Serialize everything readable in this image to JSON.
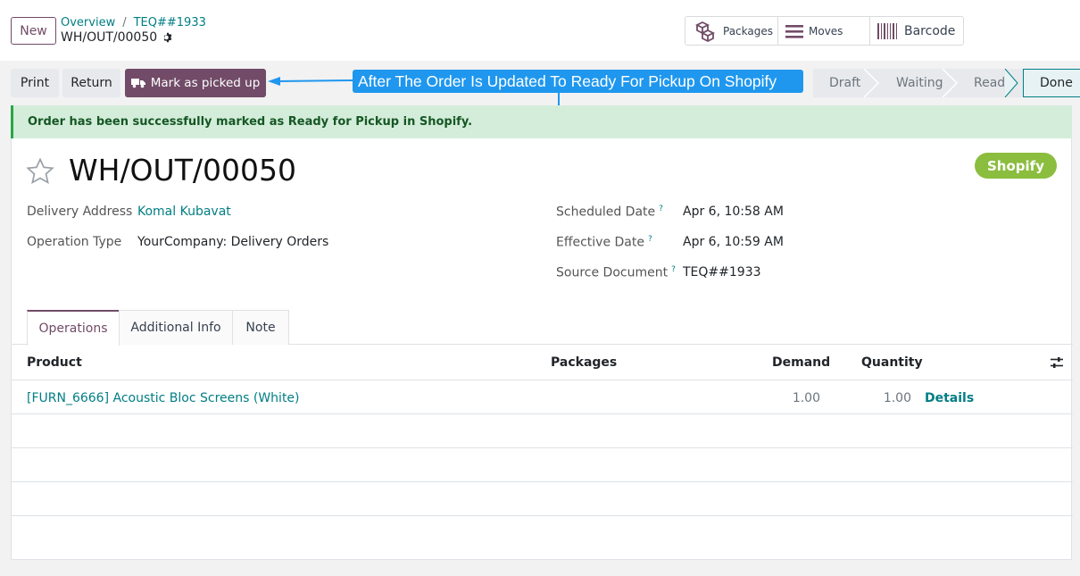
{
  "breadcrumb": {
    "new_label": "New",
    "overview": "Overview",
    "separator": "/",
    "source": "TEQ##1933",
    "record": "WH/OUT/00050"
  },
  "smart_buttons": {
    "packages": "Packages",
    "moves": "Moves",
    "barcode": "Barcode"
  },
  "actions": {
    "print": "Print",
    "return": "Return",
    "mark_picked": "Mark as picked up"
  },
  "annotation": "After The Order Is Updated To Ready For Pickup On Shopify",
  "statusbar": {
    "stages": [
      "Draft",
      "Waiting",
      "Ready",
      "Done"
    ],
    "current": "Done"
  },
  "alert": "Order has been successfully marked as Ready for Pickup in Shopify.",
  "record": {
    "title": "WH/OUT/00050",
    "tag": "Shopify",
    "delivery_address_label": "Delivery Address",
    "delivery_address": "Komal Kubavat",
    "operation_type_label": "Operation Type",
    "operation_type": "YourCompany: Delivery Orders",
    "scheduled_date_label": "Scheduled Date",
    "scheduled_date": "Apr 6, 10:58 AM",
    "effective_date_label": "Effective Date",
    "effective_date": "Apr 6, 10:59 AM",
    "source_document_label": "Source Document",
    "source_document": "TEQ##1933",
    "help_mark": "?"
  },
  "tabs": [
    "Operations",
    "Additional Info",
    "Note"
  ],
  "table": {
    "headers": {
      "product": "Product",
      "packages": "Packages",
      "demand": "Demand",
      "quantity": "Quantity"
    },
    "rows": [
      {
        "product": "[FURN_6666] Acoustic Bloc Screens (White)",
        "packages": "",
        "demand": "1.00",
        "quantity": "1.00",
        "details": "Details"
      }
    ]
  },
  "colors": {
    "brand": "#714b67",
    "link": "#017e84",
    "alert_bg": "#d4edda",
    "annotation": "#1f97ee",
    "tag": "#8bbd3e"
  },
  "icons": [
    "gear-icon",
    "packages-icon",
    "moves-icon",
    "barcode-icon",
    "truck-icon",
    "star-icon",
    "settings-icon"
  ]
}
